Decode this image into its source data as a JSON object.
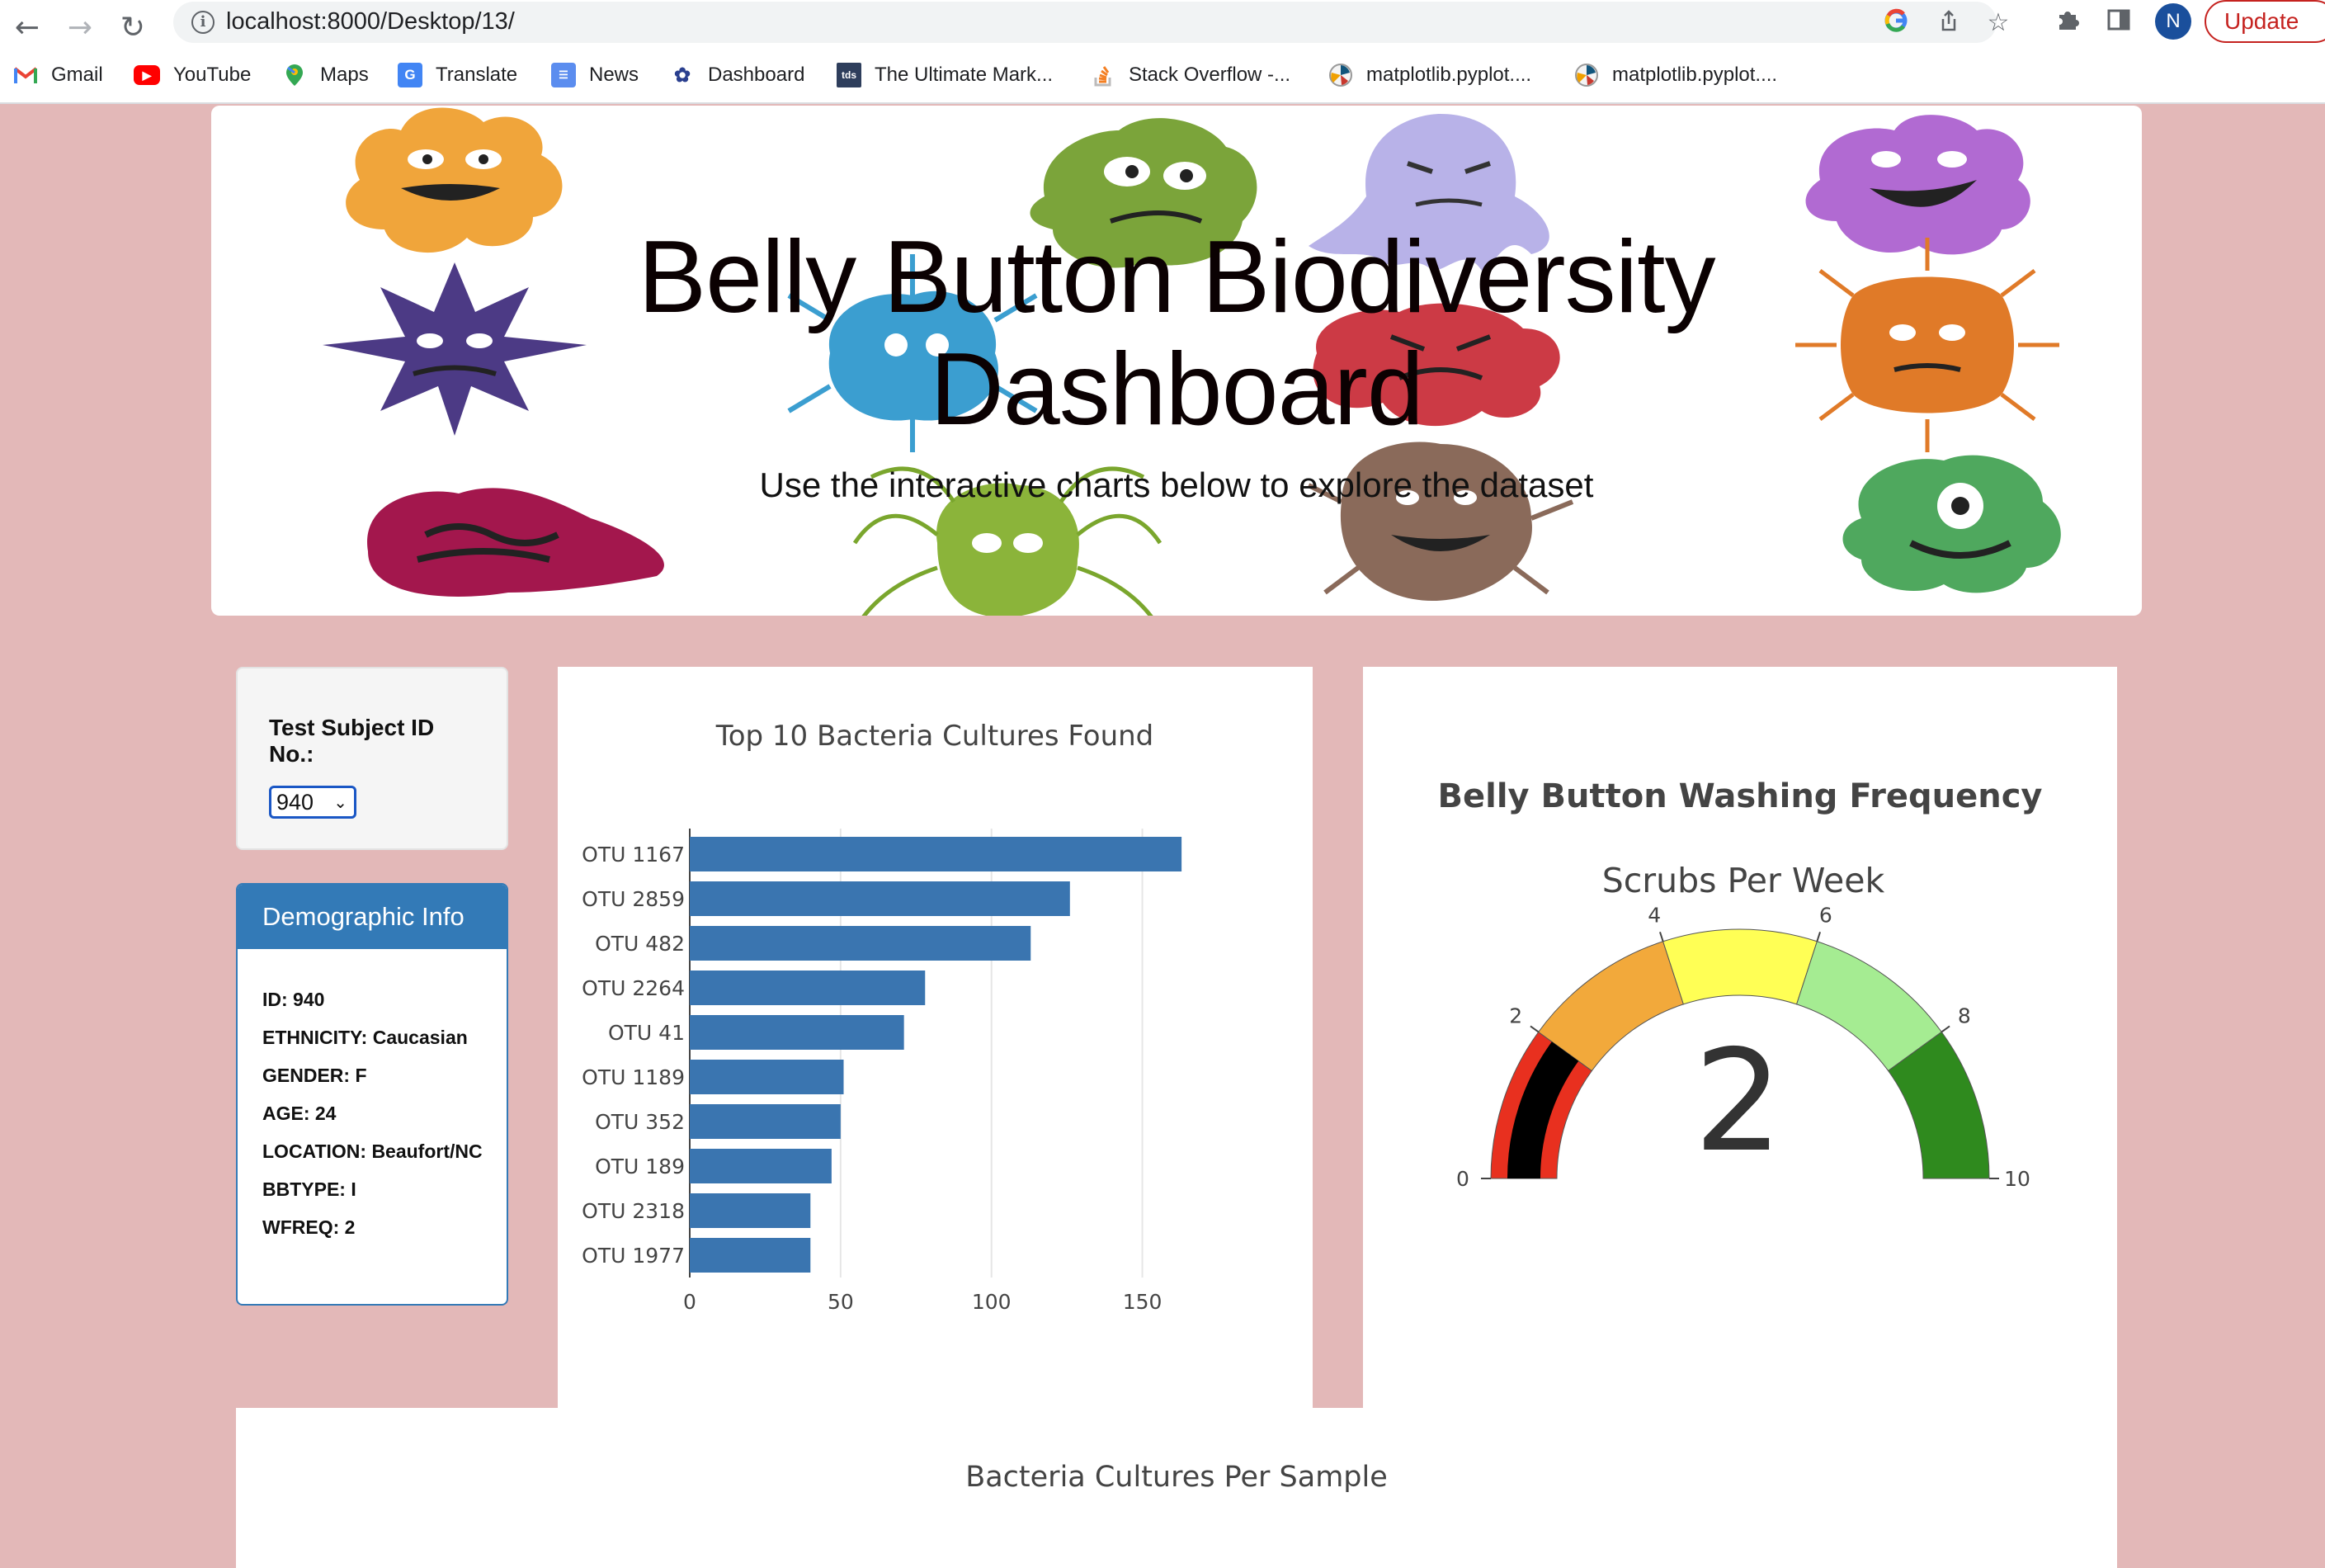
{
  "browser": {
    "url": "localhost:8000/Desktop/13/",
    "update_label": "Update",
    "profile_initial": "N",
    "bookmarks": [
      {
        "label": "Gmail",
        "icon": "gmail-icon"
      },
      {
        "label": "YouTube",
        "icon": "youtube-icon"
      },
      {
        "label": "Maps",
        "icon": "maps-icon"
      },
      {
        "label": "Translate",
        "icon": "translate-icon"
      },
      {
        "label": "News",
        "icon": "news-icon"
      },
      {
        "label": "Dashboard",
        "icon": "dashboard-icon"
      },
      {
        "label": "The Ultimate Mark...",
        "icon": "tds-icon"
      },
      {
        "label": "Stack Overflow -...",
        "icon": "stackoverflow-icon"
      },
      {
        "label": "matplotlib.pyplot....",
        "icon": "matplotlib-icon"
      },
      {
        "label": "matplotlib.pyplot....",
        "icon": "matplotlib-icon"
      }
    ],
    "tds_text": "tds"
  },
  "header": {
    "title_line1": "Belly Button Biodiversity",
    "title_line2": "Dashboard",
    "subtitle": "Use the interactive charts below to explore the dataset"
  },
  "selector": {
    "label": "Test Subject ID No.:",
    "value": "940"
  },
  "demographics": {
    "heading": "Demographic Info",
    "items": [
      "ID: 940",
      "ETHNICITY: Caucasian",
      "GENDER: F",
      "AGE: 24",
      "LOCATION: Beaufort/NC",
      "BBTYPE: I",
      "WFREQ: 2"
    ]
  },
  "chart_data": [
    {
      "type": "bar",
      "orientation": "horizontal",
      "title": "Top 10 Bacteria Cultures Found",
      "categories": [
        "OTU 1167",
        "OTU 2859",
        "OTU 482",
        "OTU 2264",
        "OTU 41",
        "OTU 1189",
        "OTU 352",
        "OTU 189",
        "OTU 2318",
        "OTU 1977"
      ],
      "values": [
        163,
        126,
        113,
        78,
        71,
        51,
        50,
        47,
        40,
        40
      ],
      "xlim": [
        0,
        175
      ],
      "xticks": [
        0,
        50,
        100,
        150
      ],
      "color": "#3a75b0",
      "grid": true
    },
    {
      "type": "gauge",
      "title": "Belly Button Washing Frequency",
      "subtitle": "Scrubs Per Week",
      "value": 2,
      "range": [
        0,
        10
      ],
      "ticks": [
        0,
        2,
        4,
        6,
        8,
        10
      ],
      "bands": [
        {
          "from": 0,
          "to": 2,
          "color": "#e8301f"
        },
        {
          "from": 2,
          "to": 4,
          "color": "#f2a93b"
        },
        {
          "from": 4,
          "to": 6,
          "color": "#ffff55"
        },
        {
          "from": 6,
          "to": 8,
          "color": "#a5ec92"
        },
        {
          "from": 8,
          "to": 10,
          "color": "#2f8a1e"
        }
      ],
      "bar_color": "#000000"
    }
  ],
  "bubble": {
    "title": "Bacteria Cultures Per Sample"
  }
}
